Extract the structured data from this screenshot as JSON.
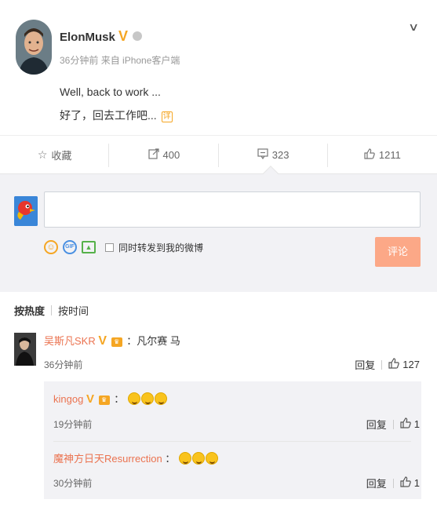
{
  "post": {
    "author": "ElonMusk",
    "verified_mark": "V",
    "time": "36分钟前",
    "source": "来自 iPhone客户端",
    "text_en": "Well, back to work ...",
    "text_zh": "好了，回去工作吧...",
    "expand_label": "详"
  },
  "actions": {
    "favorite_label": "收藏",
    "repost_count": "400",
    "comment_count": "323",
    "like_count": "1211"
  },
  "composer": {
    "input_value": "",
    "gif_label": "GIF",
    "repost_checkbox_label": "同时转发到我的微博",
    "submit_label": "评论"
  },
  "sort_tabs": {
    "hot": "按热度",
    "time": "按时间"
  },
  "comments": [
    {
      "user": "吴斯凡SKR",
      "verified_mark": "V",
      "text": "：凡尔赛 马",
      "time": "36分钟前",
      "reply_label": "回复",
      "likes": "127",
      "replies": [
        {
          "user": "kingog",
          "verified_mark": "V",
          "text": "：",
          "emoji_count": 3,
          "time": "19分钟前",
          "reply_label": "回复",
          "likes": "1"
        },
        {
          "user": "魔神方日天Resurrection",
          "text": "：",
          "emoji_count": 3,
          "time": "30分钟前",
          "reply_label": "回复",
          "likes": "1"
        }
      ]
    }
  ],
  "icons": {
    "menu": "chevron-down-icon",
    "favorite": "star-icon",
    "repost": "repost-icon",
    "comment": "comment-icon",
    "like": "thumbs-up-icon"
  },
  "colors": {
    "username": "#eb7350",
    "verified": "#f5a623",
    "submit_button": "#fca887",
    "panel_bg": "#f2f2f5"
  }
}
